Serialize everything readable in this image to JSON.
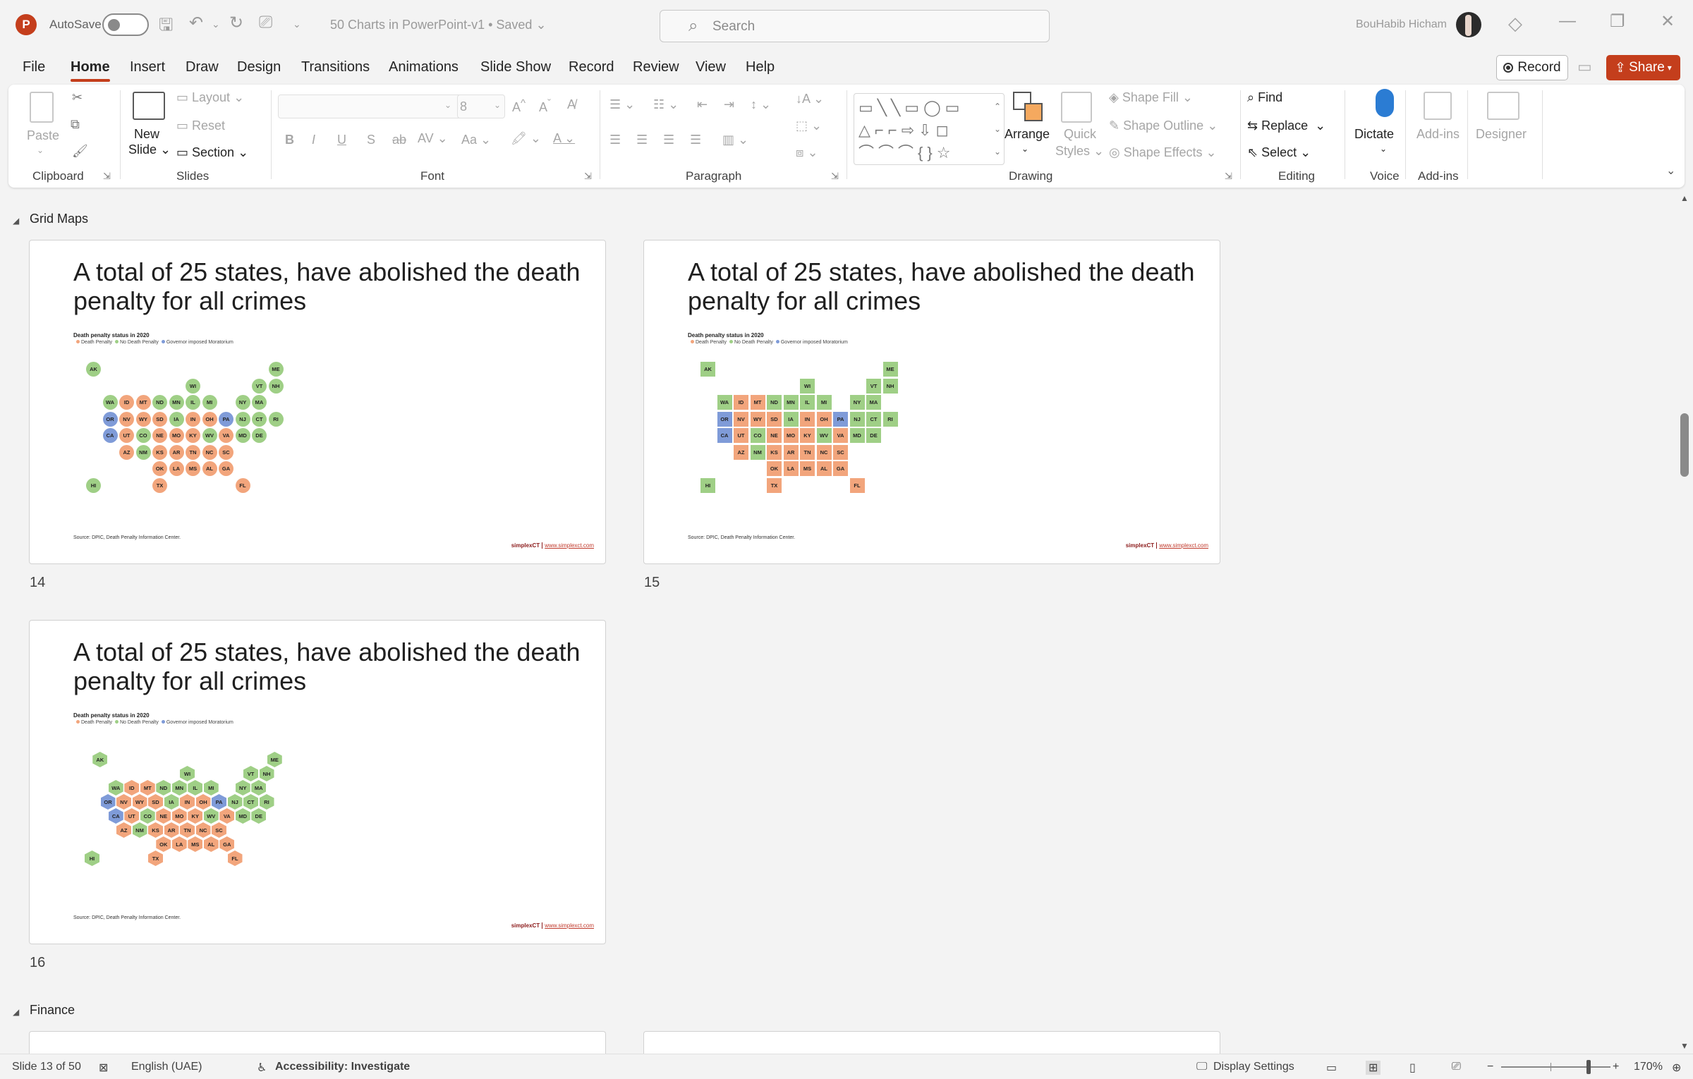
{
  "app": {
    "logo_letter": "P",
    "autosave_label": "AutoSave",
    "doc_title": "50 Charts in PowerPoint-v1 • Saved",
    "search_placeholder": "Search",
    "user_name": "BouHabib Hicham"
  },
  "menu": {
    "items": [
      "File",
      "Home",
      "Insert",
      "Draw",
      "Design",
      "Transitions",
      "Animations",
      "Slide Show",
      "Record",
      "Review",
      "View",
      "Help"
    ],
    "active": "Home",
    "record_label": "Record",
    "share_label": "Share"
  },
  "ribbon": {
    "clipboard": {
      "label": "Clipboard",
      "paste": "Paste"
    },
    "slides": {
      "label": "Slides",
      "new_slide": "New",
      "new_slide2": "Slide",
      "layout": "Layout",
      "reset": "Reset",
      "section": "Section"
    },
    "font": {
      "label": "Font",
      "size_value": "8"
    },
    "paragraph": {
      "label": "Paragraph"
    },
    "drawing": {
      "label": "Drawing",
      "arrange": "Arrange",
      "quick_styles": "Quick",
      "quick_styles2": "Styles",
      "shape_fill": "Shape Fill",
      "shape_outline": "Shape Outline",
      "shape_effects": "Shape Effects"
    },
    "editing": {
      "label": "Editing",
      "find": "Find",
      "replace": "Replace",
      "select": "Select"
    },
    "voice": {
      "label": "Voice",
      "dictate": "Dictate"
    },
    "addins": {
      "label": "Add-ins",
      "addins_btn": "Add-ins"
    },
    "designer": {
      "designer_btn": "Designer"
    }
  },
  "sections": {
    "grid_maps": "Grid Maps",
    "finance": "Finance"
  },
  "slide_common": {
    "title": "A total of 25 states, have abolished the death penalty for all crimes",
    "subtitle": "Death penalty status in 2020",
    "legend": [
      "Death Penalty",
      "No Death Penalty",
      "Governor imposed Moratorium"
    ],
    "source": "Source: DPIC, Death Penalty Information Center.",
    "brand": "simplexCT",
    "brand_url": "www.simplexct.com"
  },
  "slides": [
    {
      "number": "14",
      "tile_style": "circle"
    },
    {
      "number": "15",
      "tile_style": "square"
    },
    {
      "number": "16",
      "tile_style": "hex"
    }
  ],
  "map_colors": {
    "dp": "#f2a57c",
    "ndp": "#9fcf86",
    "mor": "#7f9bd8"
  },
  "states": [
    {
      "code": "AK",
      "status": "ndp"
    },
    {
      "code": "ME",
      "status": "ndp"
    },
    {
      "code": "WI",
      "status": "ndp"
    },
    {
      "code": "VT",
      "status": "ndp"
    },
    {
      "code": "NH",
      "status": "ndp"
    },
    {
      "code": "WA",
      "status": "ndp"
    },
    {
      "code": "ID",
      "status": "dp"
    },
    {
      "code": "MT",
      "status": "dp"
    },
    {
      "code": "ND",
      "status": "ndp"
    },
    {
      "code": "MN",
      "status": "ndp"
    },
    {
      "code": "IL",
      "status": "ndp"
    },
    {
      "code": "MI",
      "status": "ndp"
    },
    {
      "code": "NY",
      "status": "ndp"
    },
    {
      "code": "MA",
      "status": "ndp"
    },
    {
      "code": "OR",
      "status": "mor"
    },
    {
      "code": "NV",
      "status": "dp"
    },
    {
      "code": "WY",
      "status": "dp"
    },
    {
      "code": "SD",
      "status": "dp"
    },
    {
      "code": "IA",
      "status": "ndp"
    },
    {
      "code": "IN",
      "status": "dp"
    },
    {
      "code": "OH",
      "status": "dp"
    },
    {
      "code": "PA",
      "status": "mor"
    },
    {
      "code": "NJ",
      "status": "ndp"
    },
    {
      "code": "CT",
      "status": "ndp"
    },
    {
      "code": "RI",
      "status": "ndp"
    },
    {
      "code": "CA",
      "status": "mor"
    },
    {
      "code": "UT",
      "status": "dp"
    },
    {
      "code": "CO",
      "status": "ndp"
    },
    {
      "code": "NE",
      "status": "dp"
    },
    {
      "code": "MO",
      "status": "dp"
    },
    {
      "code": "KY",
      "status": "dp"
    },
    {
      "code": "WV",
      "status": "ndp"
    },
    {
      "code": "VA",
      "status": "dp"
    },
    {
      "code": "MD",
      "status": "ndp"
    },
    {
      "code": "DE",
      "status": "ndp"
    },
    {
      "code": "AZ",
      "status": "dp"
    },
    {
      "code": "NM",
      "status": "ndp"
    },
    {
      "code": "KS",
      "status": "dp"
    },
    {
      "code": "AR",
      "status": "dp"
    },
    {
      "code": "TN",
      "status": "dp"
    },
    {
      "code": "NC",
      "status": "dp"
    },
    {
      "code": "SC",
      "status": "dp"
    },
    {
      "code": "OK",
      "status": "dp"
    },
    {
      "code": "LA",
      "status": "dp"
    },
    {
      "code": "MS",
      "status": "dp"
    },
    {
      "code": "AL",
      "status": "dp"
    },
    {
      "code": "GA",
      "status": "dp"
    },
    {
      "code": "HI",
      "status": "ndp"
    },
    {
      "code": "TX",
      "status": "dp"
    },
    {
      "code": "FL",
      "status": "dp"
    }
  ],
  "status": {
    "slide_info": "Slide 13 of 50",
    "language": "English (UAE)",
    "accessibility": "Accessibility: Investigate",
    "display_settings": "Display Settings",
    "zoom": "170%"
  }
}
